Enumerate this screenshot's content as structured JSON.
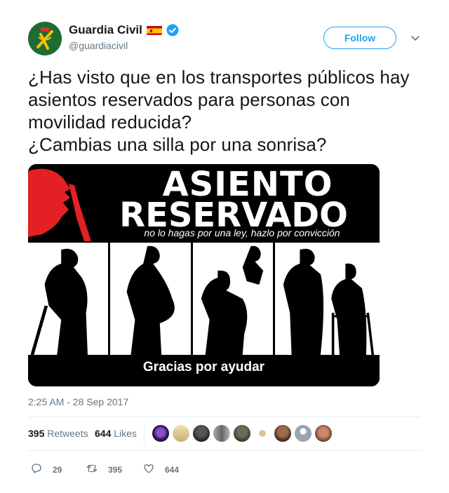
{
  "user": {
    "display_name": "Guardia Civil",
    "handle": "@guardiacivil",
    "flag_icon": "spain-flag-icon",
    "verified_icon": "verified-badge-icon"
  },
  "follow_label": "Follow",
  "tweet_text": {
    "line1": "¿Has visto que en los transportes públicos hay asientos reservados para personas con movilidad reducida?",
    "line2": "¿Cambias una silla por una sonrisa?"
  },
  "media": {
    "title_line1": "ASIENTO",
    "title_line2": "RESERVADO",
    "subtitle": "no lo hagas por una ley, hazlo por convicción",
    "footer": "Gracias por ayudar"
  },
  "timestamp": "2:25 AM - 28 Sep 2017",
  "stats": {
    "retweets_count": "395",
    "retweets_label": "Retweets",
    "likes_count": "644",
    "likes_label": "Likes"
  },
  "actions": {
    "reply_count": "29",
    "retweet_count": "395",
    "like_count": "644"
  },
  "colors": {
    "accent": "#1da1f2",
    "secondary_text": "#657786",
    "primary_text": "#14171a",
    "graphic_red": "#e32124"
  }
}
